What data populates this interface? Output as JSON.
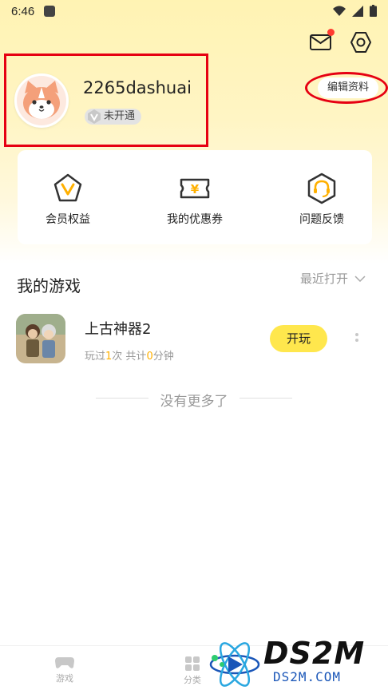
{
  "status_bar": {
    "time": "6:46"
  },
  "profile": {
    "username": "2265dashuai",
    "vip_status": "未开通",
    "edit_label": "编辑资料"
  },
  "quick_actions": [
    {
      "label": "会员权益",
      "icon": "member-v-icon"
    },
    {
      "label": "我的优惠券",
      "icon": "coupon-yen-icon"
    },
    {
      "label": "问题反馈",
      "icon": "headset-icon"
    }
  ],
  "my_games": {
    "title": "我的游戏",
    "sort_label": "最近打开",
    "games": [
      {
        "name": "上古神器2",
        "stats_prefix": "玩过",
        "play_count": "1",
        "stats_middle": "次 共计",
        "play_minutes": "0",
        "stats_suffix": "分钟",
        "play_label": "开玩"
      }
    ],
    "end_text": "没有更多了"
  },
  "bottom_nav": [
    {
      "label": "游戏",
      "icon": "gamepad-icon"
    },
    {
      "label": "分类",
      "icon": "grid-icon"
    }
  ],
  "watermark": {
    "main": "DS2M",
    "sub": "DS2M.COM"
  },
  "colors": {
    "accent_yellow": "#ffe74d",
    "highlight_orange": "#ffb000",
    "annotation_red": "#e60012",
    "notification_red": "#ff3b30"
  }
}
